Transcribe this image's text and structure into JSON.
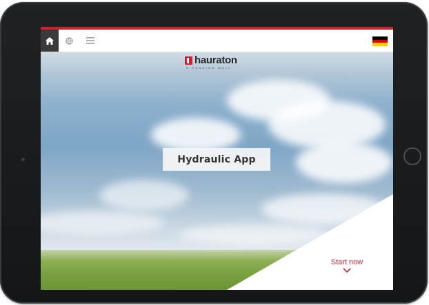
{
  "colors": {
    "brand_red": "#d21f2b",
    "toolbar_home_bg": "#3a3a3a",
    "start_now": "#e0252e",
    "flag_black": "#000000",
    "flag_red": "#dd0000",
    "flag_gold": "#ffce00"
  },
  "toolbar": {
    "home_icon": "home-icon",
    "globe_icon": "globe-icon",
    "menu_icon": "menu-icon",
    "language_flag": "germany-flag"
  },
  "logo": {
    "name": "hauraton",
    "tagline": "A RANDING WALL"
  },
  "hero": {
    "title": "Hydraulic App",
    "cta_label": "Start now",
    "cta_icon": "chevron-down-icon"
  }
}
